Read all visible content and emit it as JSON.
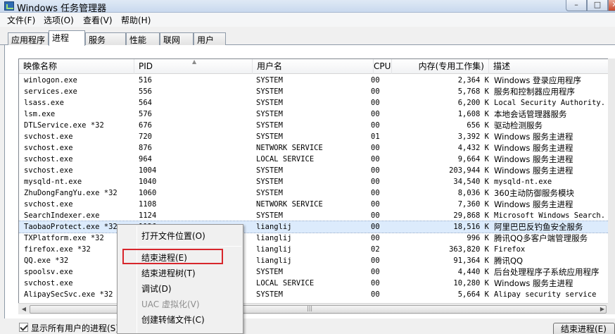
{
  "window": {
    "title": "Windows 任务管理器"
  },
  "menu": [
    "文件(F)",
    "选项(O)",
    "查看(V)",
    "帮助(H)"
  ],
  "tabs": [
    "应用程序",
    "进程",
    "服务",
    "性能",
    "联网",
    "用户"
  ],
  "active_tab": "进程",
  "columns": {
    "name": "映像名称",
    "pid": "PID",
    "user": "用户名",
    "cpu": "CPU",
    "mem": "内存(专用工作集)",
    "desc": "描述"
  },
  "rows": [
    {
      "name": "winlogon.exe",
      "pid": "516",
      "user": "SYSTEM",
      "cpu": "00",
      "mem": "2,364 K",
      "desc": "Windows 登录应用程序"
    },
    {
      "name": "services.exe",
      "pid": "556",
      "user": "SYSTEM",
      "cpu": "00",
      "mem": "5,768 K",
      "desc": "服务和控制器应用程序"
    },
    {
      "name": "lsass.exe",
      "pid": "564",
      "user": "SYSTEM",
      "cpu": "00",
      "mem": "6,200 K",
      "desc": "Local Security Authority..."
    },
    {
      "name": "lsm.exe",
      "pid": "576",
      "user": "SYSTEM",
      "cpu": "00",
      "mem": "1,608 K",
      "desc": "本地会话管理器服务"
    },
    {
      "name": "DTLService.exe *32",
      "pid": "676",
      "user": "SYSTEM",
      "cpu": "00",
      "mem": "656 K",
      "desc": "驱动检测服务"
    },
    {
      "name": "svchost.exe",
      "pid": "720",
      "user": "SYSTEM",
      "cpu": "01",
      "mem": "3,392 K",
      "desc": "Windows 服务主进程"
    },
    {
      "name": "svchost.exe",
      "pid": "876",
      "user": "NETWORK SERVICE",
      "cpu": "00",
      "mem": "4,432 K",
      "desc": "Windows 服务主进程"
    },
    {
      "name": "svchost.exe",
      "pid": "964",
      "user": "LOCAL SERVICE",
      "cpu": "00",
      "mem": "9,664 K",
      "desc": "Windows 服务主进程"
    },
    {
      "name": "svchost.exe",
      "pid": "1004",
      "user": "SYSTEM",
      "cpu": "00",
      "mem": "203,944 K",
      "desc": "Windows 服务主进程"
    },
    {
      "name": "mysqld-nt.exe",
      "pid": "1040",
      "user": "SYSTEM",
      "cpu": "00",
      "mem": "34,540 K",
      "desc": "mysqld-nt.exe"
    },
    {
      "name": "ZhuDongFangYu.exe *32",
      "pid": "1060",
      "user": "SYSTEM",
      "cpu": "00",
      "mem": "8,036 K",
      "desc": "360主动防御服务模块"
    },
    {
      "name": "svchost.exe",
      "pid": "1108",
      "user": "NETWORK SERVICE",
      "cpu": "00",
      "mem": "7,360 K",
      "desc": "Windows 服务主进程"
    },
    {
      "name": "SearchIndexer.exe",
      "pid": "1124",
      "user": "SYSTEM",
      "cpu": "00",
      "mem": "29,868 K",
      "desc": "Microsoft Windows Search..."
    },
    {
      "name": "TaobaoProtect.exe *32",
      "pid": "1136",
      "user": "lianglij",
      "cpu": "00",
      "mem": "18,516 K",
      "desc": "阿里巴巴反钓鱼安全服务",
      "selected": true
    },
    {
      "name": "TXPlatform.exe *32",
      "pid": "",
      "user": "lianglij",
      "cpu": "00",
      "mem": "996 K",
      "desc": "腾讯QQ多客户端管理服务"
    },
    {
      "name": "firefox.exe *32",
      "pid": "",
      "user": "lianglij",
      "cpu": "02",
      "mem": "363,820 K",
      "desc": "Firefox"
    },
    {
      "name": "QQ.exe *32",
      "pid": "",
      "user": "lianglij",
      "cpu": "00",
      "mem": "91,364 K",
      "desc": "腾讯QQ"
    },
    {
      "name": "spoolsv.exe",
      "pid": "",
      "user": "SYSTEM",
      "cpu": "00",
      "mem": "4,440 K",
      "desc": "后台处理程序子系统应用程序"
    },
    {
      "name": "svchost.exe",
      "pid": "",
      "user": "LOCAL SERVICE",
      "cpu": "00",
      "mem": "10,280 K",
      "desc": "Windows 服务主进程"
    },
    {
      "name": "AlipaySecSvc.exe *32",
      "pid": "",
      "user": "SYSTEM",
      "cpu": "00",
      "mem": "5,664 K",
      "desc": "Alipay security service"
    }
  ],
  "context_menu": {
    "items": [
      "打开文件位置(O)",
      "结束进程(E)",
      "结束进程树(T)",
      "调试(D)",
      "UAC 虚拟化(V)",
      "创建转储文件(C)"
    ]
  },
  "bottom": {
    "show_all_label": "显示所有用户的进程(S)",
    "end_button": "结束进程(E)"
  }
}
